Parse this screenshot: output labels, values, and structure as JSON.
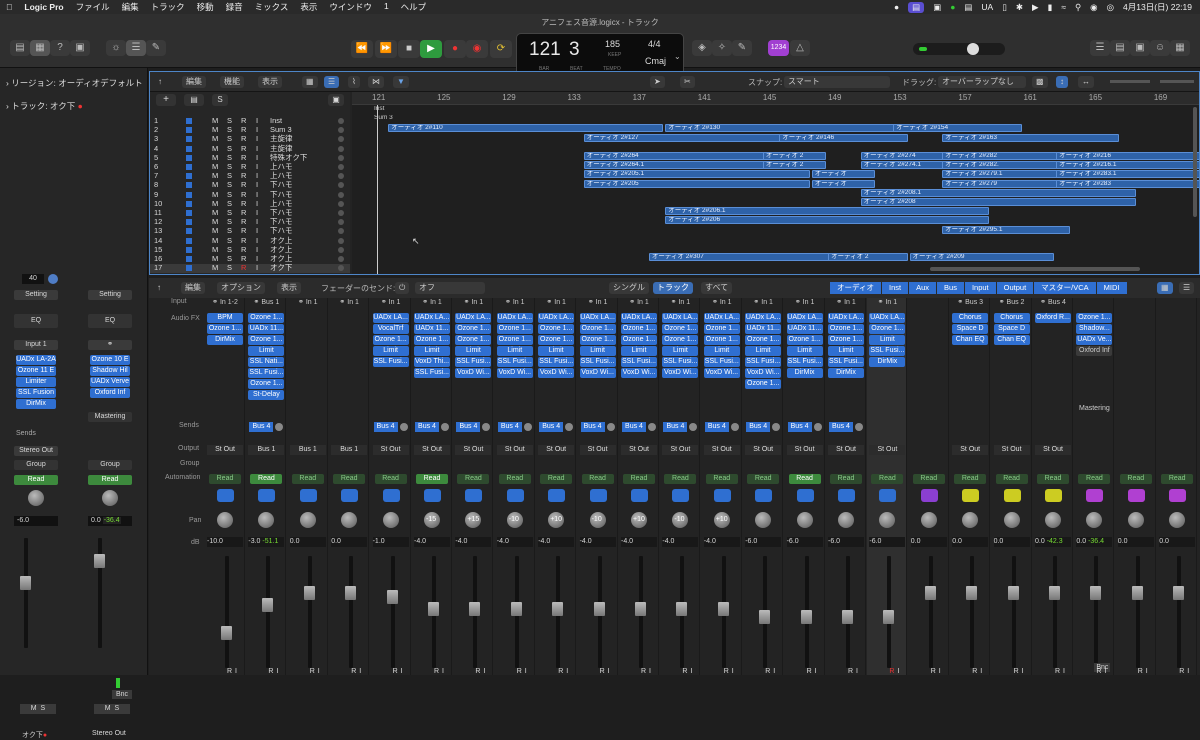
{
  "menubar": {
    "app": "Logic Pro",
    "items": [
      "ファイル",
      "編集",
      "トラック",
      "移動",
      "録音",
      "ミックス",
      "表示",
      "ウインドウ",
      "1",
      "ヘルプ"
    ],
    "lang": "UA",
    "datetime": "4月13日(日) 22:19"
  },
  "window": {
    "title": "アニフェス音源.logicx - トラック"
  },
  "lcd": {
    "bar": "121",
    "beat": "3",
    "bar_label": "BAR",
    "beat_label": "BEAT",
    "tempo": "185",
    "keep": "KEEP",
    "tempo_label": "TEMPO",
    "sig": "4/4",
    "key": "Cmaj",
    "counter": "1234"
  },
  "inspector": {
    "region": "リージョン: オーディオデフォルト",
    "track": "トラック: オク下",
    "num": "40",
    "setting": "Setting",
    "eq": "EQ",
    "input": "Input 1",
    "sends": "Sends",
    "stereo_out": "Stereo Out",
    "group": "Group",
    "read": "Read",
    "vol1": "-6.0",
    "vol2a": "0.0",
    "vol2b": "-36.4",
    "mastering": "Mastering",
    "bnc": "Bnc",
    "name1": "オク下",
    "name2": "Stereo Out",
    "plugins1": [
      "UADx LA-2A",
      "Ozone 11 E",
      "Limiter",
      "SSL Fusion",
      "DirMix"
    ],
    "plugins2": [
      "Ozone 10 E",
      "Shadow Hil",
      "UADx Verve",
      "Oxford Inf"
    ]
  },
  "tracks_toolbar": {
    "edit": "編集",
    "func": "機能",
    "view": "表示",
    "snap_label": "スナップ:",
    "snap": "スマート",
    "drag_label": "ドラッグ:",
    "drag": "オーバーラップなし"
  },
  "ruler": [
    "121",
    "125",
    "129",
    "133",
    "137",
    "141",
    "145",
    "149",
    "153",
    "157",
    "161",
    "165",
    "169"
  ],
  "tracks": [
    {
      "n": "1",
      "name": "Inst"
    },
    {
      "n": "2",
      "name": "Sum 3"
    },
    {
      "n": "3",
      "name": "主旋律"
    },
    {
      "n": "4",
      "name": "主旋律"
    },
    {
      "n": "5",
      "name": "特殊オク下"
    },
    {
      "n": "6",
      "name": "上ハモ"
    },
    {
      "n": "7",
      "name": "上ハモ"
    },
    {
      "n": "8",
      "name": "下ハモ"
    },
    {
      "n": "9",
      "name": "下ハモ"
    },
    {
      "n": "10",
      "name": "上ハモ"
    },
    {
      "n": "11",
      "name": "下ハモ"
    },
    {
      "n": "12",
      "name": "下ハモ"
    },
    {
      "n": "13",
      "name": "下ハモ"
    },
    {
      "n": "14",
      "name": "オク上"
    },
    {
      "n": "15",
      "name": "オク上"
    },
    {
      "n": "16",
      "name": "オク上"
    },
    {
      "n": "17",
      "name": "オク下"
    }
  ],
  "regions": [
    {
      "row": 0,
      "bar": 121,
      "len": 3,
      "label": "Inst"
    },
    {
      "row": 1,
      "bar": 121,
      "len": 2,
      "label": "Sum 3"
    },
    {
      "row": 2,
      "bar": 122,
      "len": 17,
      "label": "オーディオ 2#110"
    },
    {
      "row": 2,
      "bar": 139,
      "len": 15,
      "label": "オーディオ 2#130"
    },
    {
      "row": 2,
      "bar": 153,
      "len": 8,
      "label": "オーディオ 2#154"
    },
    {
      "row": 3,
      "bar": 134,
      "len": 14,
      "label": "オーディオ 2#127"
    },
    {
      "row": 3,
      "bar": 146,
      "len": 8,
      "label": "オーディオ 2#146"
    },
    {
      "row": 3,
      "bar": 156,
      "len": 11,
      "label": "オーディオ 2#163"
    },
    {
      "row": 5,
      "bar": 134,
      "len": 13,
      "label": "オーディオ 2#264"
    },
    {
      "row": 5,
      "bar": 145,
      "len": 4,
      "label": "オーディオ 2"
    },
    {
      "row": 5,
      "bar": 151,
      "len": 12,
      "label": "オーディオ 2#274"
    },
    {
      "row": 5,
      "bar": 156,
      "len": 9,
      "label": "オーディオ 2#282"
    },
    {
      "row": 5,
      "bar": 163,
      "len": 9,
      "label": "オーディオ 2#216"
    },
    {
      "row": 6,
      "bar": 134,
      "len": 13,
      "label": "オーディオ 2#264.1"
    },
    {
      "row": 6,
      "bar": 145,
      "len": 4,
      "label": "オーディオ 2"
    },
    {
      "row": 6,
      "bar": 151,
      "len": 12,
      "label": "オーディオ 2#274.1"
    },
    {
      "row": 6,
      "bar": 156,
      "len": 9,
      "label": "オーディオ 2#282."
    },
    {
      "row": 6,
      "bar": 163,
      "len": 9,
      "label": "オーディオ 2#216.1"
    },
    {
      "row": 7,
      "bar": 134,
      "len": 14,
      "label": "オーディオ 2#205.1"
    },
    {
      "row": 7,
      "bar": 148,
      "len": 4,
      "label": "オーディオ"
    },
    {
      "row": 7,
      "bar": 156,
      "len": 9,
      "label": "オーディオ 2#279.1"
    },
    {
      "row": 7,
      "bar": 163,
      "len": 9,
      "label": "オーディオ 2#283.1"
    },
    {
      "row": 8,
      "bar": 134,
      "len": 14,
      "label": "オーディオ 2#205"
    },
    {
      "row": 8,
      "bar": 148,
      "len": 4,
      "label": "オーディオ"
    },
    {
      "row": 8,
      "bar": 156,
      "len": 9,
      "label": "オーディオ 2#279"
    },
    {
      "row": 8,
      "bar": 163,
      "len": 9,
      "label": "オーディオ 2#283"
    },
    {
      "row": 9,
      "bar": 151,
      "len": 17,
      "label": "オーディオ 2#208.1"
    },
    {
      "row": 10,
      "bar": 151,
      "len": 17,
      "label": "オーディオ 2#208"
    },
    {
      "row": 11,
      "bar": 139,
      "len": 20,
      "label": "オーディオ 2#206.1"
    },
    {
      "row": 12,
      "bar": 139,
      "len": 20,
      "label": "オーディオ 2#206"
    },
    {
      "row": 13,
      "bar": 156,
      "len": 8,
      "label": "オーディオ 2#295.1"
    },
    {
      "row": 16,
      "bar": 138,
      "len": 14,
      "label": "オーディオ 2#307"
    },
    {
      "row": 16,
      "bar": 149,
      "len": 5,
      "label": "オーディオ 2"
    },
    {
      "row": 16,
      "bar": 154,
      "len": 9,
      "label": "オーディオ 2#209"
    }
  ],
  "mixer_toolbar": {
    "edit": "編集",
    "options": "オプション",
    "view": "表示",
    "fader_send": "フェーダーのセンド:",
    "off": "オフ",
    "single": "シングル",
    "tracks": "トラック",
    "all": "すべて",
    "filters": [
      "オーディオ",
      "Inst",
      "Aux",
      "Bus",
      "Input",
      "Output",
      "マスター/VCA",
      "MIDI"
    ]
  },
  "mixer_labels": {
    "input": "Input",
    "fx": "Audio FX",
    "sends": "Sends",
    "output": "Output",
    "group": "Group",
    "automation": "Automation",
    "pan": "Pan",
    "db": "dB"
  },
  "channels": [
    {
      "in": "In 1-2",
      "fx": [
        "BPM",
        "Ozone 1...",
        "DirMix"
      ],
      "send": "",
      "out": "St Out",
      "pan": "",
      "db": "-10.0",
      "db2": "",
      "color": "#2f6fd1"
    },
    {
      "in": "Bus 1",
      "fx": [
        "Ozone 1...",
        "UADx 11...",
        "Ozone 1...",
        "Limit",
        "SSL Nati...",
        "SSL Fusi...",
        "Ozone 1...",
        "St-Delay"
      ],
      "send": "Bus 4",
      "out": "Bus 1",
      "pan": "",
      "db": "-3.0",
      "db2": "-51.1",
      "color": "#2f6fd1"
    },
    {
      "in": "In 1",
      "fx": [],
      "send": "",
      "out": "Bus 1",
      "pan": "",
      "db": "0.0",
      "db2": "",
      "color": "#2f6fd1"
    },
    {
      "in": "In 1",
      "fx": [],
      "send": "",
      "out": "Bus 1",
      "pan": "",
      "db": "0.0",
      "db2": "",
      "color": "#2f6fd1"
    },
    {
      "in": "In 1",
      "fx": [
        "UADx LA...",
        "VocalTrf",
        "Ozone 1...",
        "Limit",
        "SSL Fusi..."
      ],
      "send": "Bus 4",
      "out": "St Out",
      "pan": "",
      "db": "-1.0",
      "db2": "",
      "color": "#2f6fd1"
    },
    {
      "in": "In 1",
      "fx": [
        "UADx LA...",
        "UADx 11...",
        "Ozone 1...",
        "Limit",
        "VoxD Thi...",
        "SSL Fusi..."
      ],
      "send": "Bus 4",
      "out": "St Out",
      "pan": "-15",
      "db": "-4.0",
      "db2": "",
      "color": "#2f6fd1"
    },
    {
      "in": "In 1",
      "fx": [
        "UADx LA...",
        "Ozone 1...",
        "Ozone 1...",
        "Limit",
        "SSL Fusi...",
        "VoxD Wi..."
      ],
      "send": "Bus 4",
      "out": "St Out",
      "pan": "+15",
      "db": "-4.0",
      "db2": "",
      "color": "#2f6fd1"
    },
    {
      "in": "In 1",
      "fx": [
        "UADx LA...",
        "Ozone 1...",
        "Ozone 1...",
        "Limit",
        "SSL Fusi...",
        "VoxD Wi..."
      ],
      "send": "Bus 4",
      "out": "St Out",
      "pan": "-10",
      "db": "-4.0",
      "db2": "",
      "color": "#2f6fd1"
    },
    {
      "in": "In 1",
      "fx": [
        "UADx LA...",
        "Ozone 1...",
        "Ozone 1...",
        "Limit",
        "SSL Fusi...",
        "VoxD Wi..."
      ],
      "send": "Bus 4",
      "out": "St Out",
      "pan": "+10",
      "db": "-4.0",
      "db2": "",
      "color": "#2f6fd1"
    },
    {
      "in": "In 1",
      "fx": [
        "UADx LA...",
        "Ozone 1...",
        "Ozone 1...",
        "Limit",
        "SSL Fusi...",
        "VoxD Wi..."
      ],
      "send": "Bus 4",
      "out": "St Out",
      "pan": "-10",
      "db": "-4.0",
      "db2": "",
      "color": "#2f6fd1"
    },
    {
      "in": "In 1",
      "fx": [
        "UADx LA...",
        "Ozone 1...",
        "Ozone 1...",
        "Limit",
        "SSL Fusi...",
        "VoxD Wi..."
      ],
      "send": "Bus 4",
      "out": "St Out",
      "pan": "+10",
      "db": "-4.0",
      "db2": "",
      "color": "#2f6fd1"
    },
    {
      "in": "In 1",
      "fx": [
        "UADx LA...",
        "Ozone 1...",
        "Ozone 1...",
        "Limit",
        "SSL Fusi...",
        "VoxD Wi..."
      ],
      "send": "Bus 4",
      "out": "St Out",
      "pan": "-10",
      "db": "-4.0",
      "db2": "",
      "color": "#2f6fd1"
    },
    {
      "in": "In 1",
      "fx": [
        "UADx LA...",
        "Ozone 1...",
        "Ozone 1...",
        "Limit",
        "SSL Fusi...",
        "VoxD Wi..."
      ],
      "send": "Bus 4",
      "out": "St Out",
      "pan": "+10",
      "db": "-4.0",
      "db2": "",
      "color": "#2f6fd1"
    },
    {
      "in": "In 1",
      "fx": [
        "UADx LA...",
        "UADx 11...",
        "Ozone 1...",
        "Limit",
        "SSL Fusi...",
        "VoxD Wi...",
        "Ozone 1..."
      ],
      "send": "Bus 4",
      "out": "St Out",
      "pan": "",
      "db": "-6.0",
      "db2": "",
      "color": "#2f6fd1"
    },
    {
      "in": "In 1",
      "fx": [
        "UADx LA...",
        "UADx 11...",
        "Ozone 1...",
        "Limit",
        "SSL Fusi...",
        "DirMix"
      ],
      "send": "Bus 4",
      "out": "St Out",
      "pan": "",
      "db": "-6.0",
      "db2": "",
      "color": "#2f6fd1"
    },
    {
      "in": "In 1",
      "fx": [
        "UADx LA...",
        "Ozone 1...",
        "Ozone 1...",
        "Limit",
        "SSL Fusi...",
        "DirMix"
      ],
      "send": "Bus 4",
      "out": "St Out",
      "pan": "",
      "db": "-6.0",
      "db2": "",
      "color": "#2f6fd1"
    },
    {
      "in": "In 1",
      "fx": [
        "UADx LA...",
        "Ozone 1...",
        "Limit",
        "SSL Fusi...",
        "DirMix"
      ],
      "send": "",
      "out": "St Out",
      "pan": "",
      "db": "-6.0",
      "db2": "",
      "color": "#2f6fd1"
    },
    {
      "in": "",
      "fx": [],
      "send": "",
      "out": "",
      "pan": "",
      "db": "0.0",
      "db2": "",
      "color": "#8b3fd1"
    },
    {
      "in": "Bus 3",
      "fx": [
        "Chorus",
        "Space D",
        "Chan EQ"
      ],
      "send": "",
      "out": "St Out",
      "pan": "",
      "db": "0.0",
      "db2": "",
      "color": "#cccc22"
    },
    {
      "in": "Bus 2",
      "fx": [
        "Chorus",
        "Space D",
        "Chan EQ"
      ],
      "send": "",
      "out": "St Out",
      "pan": "",
      "db": "0.0",
      "db2": "",
      "color": "#cccc22"
    },
    {
      "in": "Bus 4",
      "fx": [
        "Oxford R..."
      ],
      "send": "",
      "out": "St Out",
      "pan": "",
      "db": "0.0",
      "db2": "-42.3",
      "color": "#cccc22"
    },
    {
      "in": "",
      "fx": [
        "Ozone 1...",
        "Shadow...",
        "UADx Ve...",
        "Oxford Inf"
      ],
      "send": "",
      "out": "",
      "pan": "",
      "db": "0.0",
      "db2": "-36.4",
      "color": "#b040d1"
    },
    {
      "in": "",
      "fx": [],
      "send": "",
      "out": "",
      "pan": "",
      "db": "0.0",
      "db2": "",
      "color": "#b040d1"
    },
    {
      "in": "",
      "fx": [],
      "send": "",
      "out": "",
      "pan": "",
      "db": "0.0",
      "db2": "",
      "color": "#b040d1"
    }
  ],
  "strip_misc": {
    "read": "Read",
    "mastering": "Mastering",
    "bnc": "Bnc",
    "r": "R",
    "i": "I",
    "m": "M",
    "s": "S"
  }
}
